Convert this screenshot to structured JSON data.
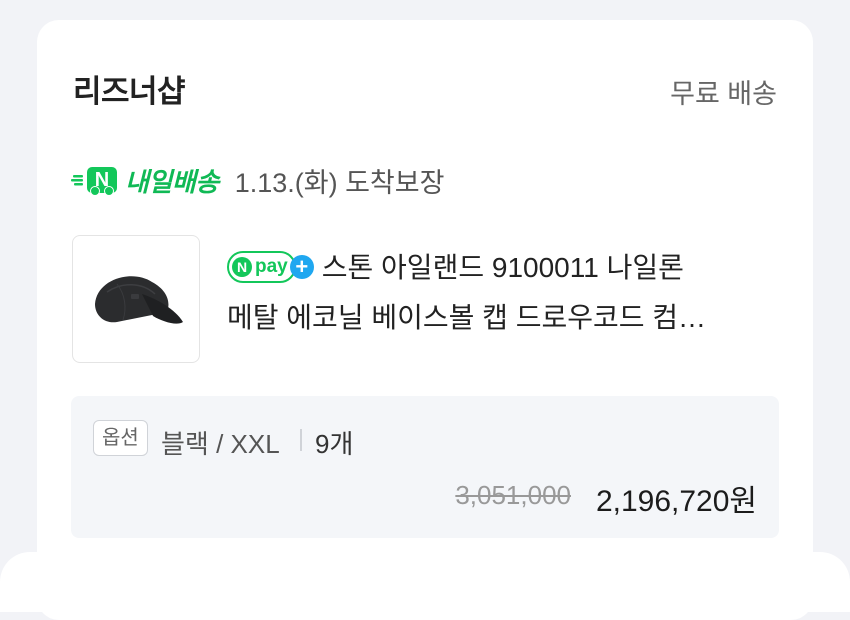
{
  "shop": {
    "name": "리즈너샵",
    "shipping_fee": "무료 배송"
  },
  "delivery": {
    "badge_letter": "N",
    "label": "내일배송",
    "text": "1.13.(화) 도착보장",
    "color": "#13c75a"
  },
  "product": {
    "npay_badge": {
      "circle": "N",
      "text": "pay",
      "plus": "+"
    },
    "title_line1": "스톤 아일랜드 9100011 나일론",
    "title_line2": "메탈 에코닐 베이스볼 캡 드로우코드 컴…",
    "thumbnail_icon": "black-baseball-cap"
  },
  "option": {
    "tag": "옵션",
    "value": "블랙 / XXL",
    "quantity": "9개",
    "original_price": "3,051,000",
    "final_price": "2,196,720원"
  }
}
